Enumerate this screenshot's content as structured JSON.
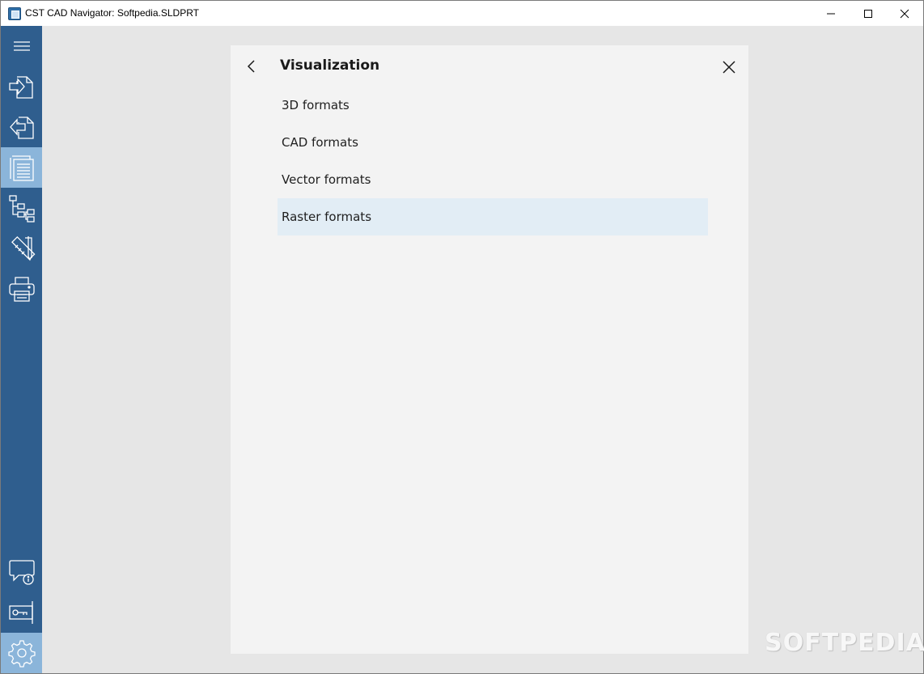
{
  "window": {
    "title": "CST CAD Navigator: Softpedia.SLDPRT"
  },
  "sidebar": {
    "items": [
      {
        "name": "menu-button",
        "icon": "hamburger-menu-icon"
      },
      {
        "name": "import-button",
        "icon": "file-import-icon"
      },
      {
        "name": "export-button",
        "icon": "file-export-icon"
      },
      {
        "name": "documents-button",
        "icon": "document-list-icon",
        "active": true
      },
      {
        "name": "structure-button",
        "icon": "tree-structure-icon"
      },
      {
        "name": "measure-button",
        "icon": "ruler-pencil-icon"
      },
      {
        "name": "print-button",
        "icon": "printer-icon"
      },
      {
        "name": "feedback-button",
        "icon": "chat-info-icon"
      },
      {
        "name": "license-button",
        "icon": "license-key-icon"
      },
      {
        "name": "settings-button",
        "icon": "gear-icon",
        "active": true
      }
    ]
  },
  "panel": {
    "title": "Visualization",
    "items": [
      {
        "label": "3D formats"
      },
      {
        "label": "CAD formats"
      },
      {
        "label": "Vector formats"
      },
      {
        "label": "Raster formats",
        "selected": true
      }
    ]
  },
  "watermark": {
    "text": "SOFTPEDIA"
  },
  "colors": {
    "sidebar": "#2f5e8e",
    "sidebar_active": "#8bb5da",
    "content_bg": "#e6e6e6",
    "panel_bg": "#f3f3f3",
    "selected_item": "#e2edf5"
  }
}
